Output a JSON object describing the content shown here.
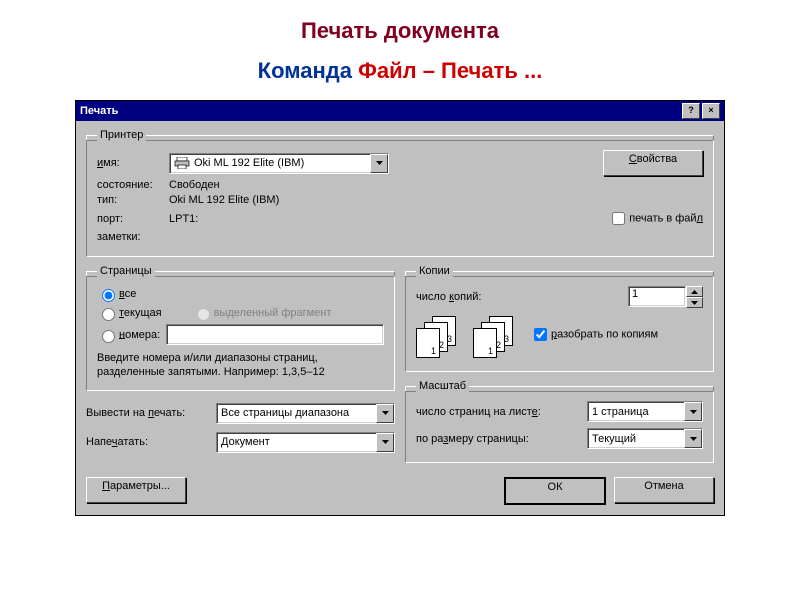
{
  "header": {
    "title": "Печать документа",
    "subtitle_blue1": "Команда ",
    "subtitle_red": "Файл – Печать ...",
    "subtitle_blue2": ""
  },
  "dialog": {
    "title": "Печать",
    "help": "?",
    "close": "×"
  },
  "printer": {
    "legend": "Принтер",
    "name_label": "имя:",
    "name_value": "Oki ML 192 Elite (IBM)",
    "properties_btn": "Свойства",
    "status_label": "состояние:",
    "status_value": "Свободен",
    "type_label": "тип:",
    "type_value": "Oki ML 192 Elite (IBM)",
    "port_label": "порт:",
    "port_value": "LPT1:",
    "notes_label": "заметки:",
    "print_to_file": "печать в файл"
  },
  "pages": {
    "legend": "Страницы",
    "all": "все",
    "current": "текущая",
    "selection": "выделенный фрагмент",
    "numbers": "номера:",
    "hint": "Введите номера и/или диапазоны страниц, разделенные запятыми. Например: 1,3,5–12"
  },
  "copies": {
    "legend": "Копии",
    "count_label": "число копий:",
    "count_value": "1",
    "collate": "разобрать по копиям"
  },
  "bottom": {
    "print_what_label": "Вывести на печать:",
    "print_what_value": "Все страницы диапазона",
    "print_label": "Напечатать:",
    "print_value": "Документ"
  },
  "scale": {
    "legend": "Масштаб",
    "pages_per_sheet_label": "число страниц на листе:",
    "pages_per_sheet_value": "1 страница",
    "fit_label": "по размеру страницы:",
    "fit_value": "Текущий"
  },
  "footer": {
    "options": "Параметры...",
    "ok": "ОК",
    "cancel": "Отмена"
  }
}
